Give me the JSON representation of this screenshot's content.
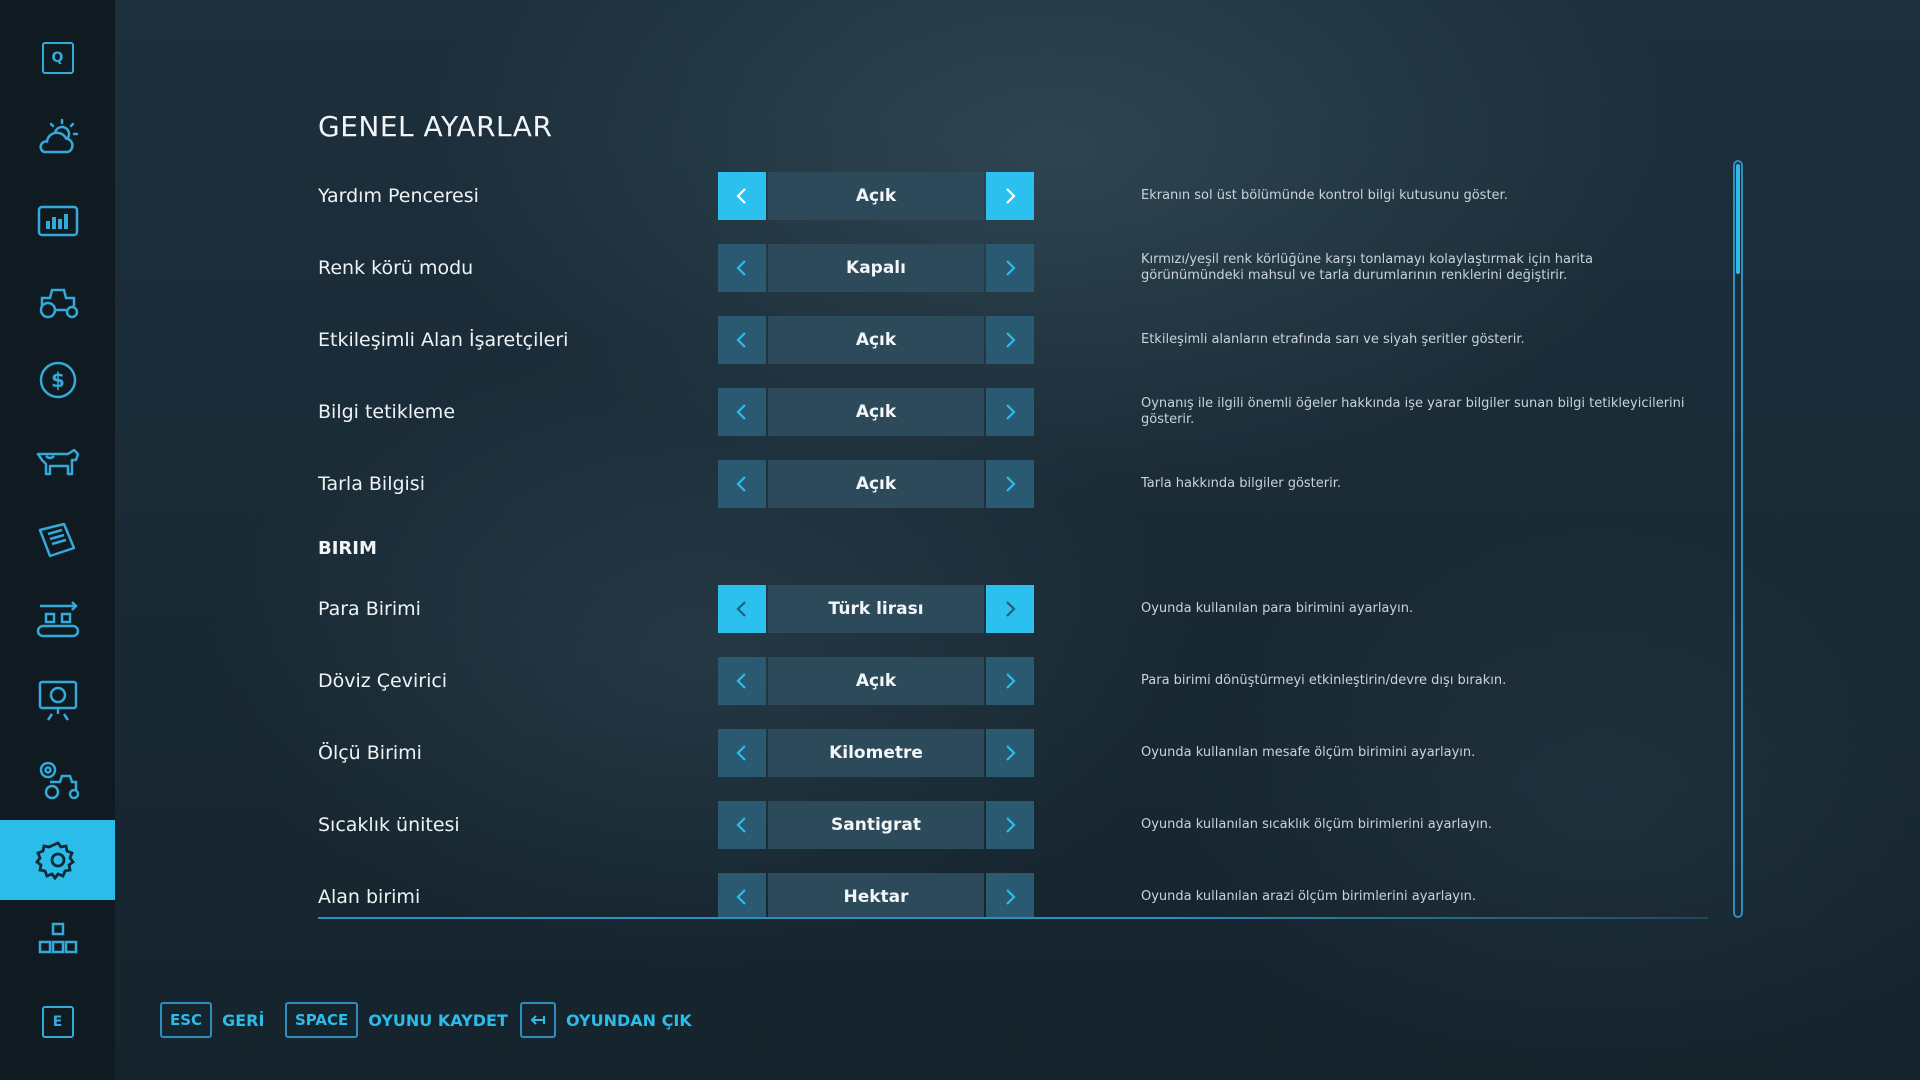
{
  "sidebar": {
    "top_key": "Q",
    "bottom_key": "E",
    "items": [
      {
        "icon": "weather-icon"
      },
      {
        "icon": "statistics-icon"
      },
      {
        "icon": "tractor-icon"
      },
      {
        "icon": "finances-icon"
      },
      {
        "icon": "animals-icon"
      },
      {
        "icon": "contracts-icon"
      },
      {
        "icon": "production-icon"
      },
      {
        "icon": "tutorial-icon"
      },
      {
        "icon": "vehicle-settings-icon"
      },
      {
        "icon": "settings-gear-icon",
        "active": true
      },
      {
        "icon": "mods-icon"
      }
    ]
  },
  "page": {
    "title": "GENEL AYARLAR"
  },
  "settings": {
    "general": [
      {
        "label": "Yardım Penceresi",
        "value": "Açık",
        "description": "Ekranın sol üst bölümünde kontrol bilgi kutusunu göster.",
        "highlighted": true
      },
      {
        "label": "Renk körü modu",
        "value": "Kapalı",
        "description": "Kırmızı/yeşil renk körlüğüne karşı tonlamayı kolaylaştırmak için harita görünümündeki mahsul ve tarla durumlarının renklerini değiştirir."
      },
      {
        "label": "Etkileşimli Alan İşaretçileri",
        "value": "Açık",
        "description": "Etkileşimli alanların etrafında sarı ve siyah şeritler gösterir."
      },
      {
        "label": "Bilgi tetikleme",
        "value": "Açık",
        "description": "Oynanış ile ilgili önemli öğeler hakkında işe yarar bilgiler sunan bilgi tetikleyicilerini gösterir."
      },
      {
        "label": "Tarla Bilgisi",
        "value": "Açık",
        "description": "Tarla hakkında bilgiler gösterir."
      }
    ],
    "unit_section_title": "BIRIM",
    "units": [
      {
        "label": "Para Birimi",
        "value": "Türk lirası",
        "description": "Oyunda kullanılan para birimini ayarlayın.",
        "highlighted": true
      },
      {
        "label": "Döviz Çevirici",
        "value": "Açık",
        "description": "Para birimi dönüştürmeyi etkinleştirin/devre dışı bırakın."
      },
      {
        "label": "Ölçü Birimi",
        "value": "Kilometre",
        "description": "Oyunda kullanılan mesafe ölçüm birimini ayarlayın."
      },
      {
        "label": "Sıcaklık ünitesi",
        "value": "Santigrat",
        "description": "Oyunda kullanılan sıcaklık ölçüm birimlerini ayarlayın."
      },
      {
        "label": "Alan birimi",
        "value": "Hektar",
        "description": "Oyunda kullanılan arazi ölçüm birimlerini ayarlayın."
      }
    ]
  },
  "footer": {
    "back": {
      "key": "ESC",
      "label": "GERİ"
    },
    "save": {
      "key": "SPACE",
      "label": "OYUNU KAYDET"
    },
    "quit": {
      "key_icon": "exit-arrow-icon",
      "label": "OYUNDAN ÇIK"
    }
  },
  "colors": {
    "accent": "#2bbcea",
    "selector_bg": "#2d4a5a",
    "arrow_bg": "#2a5a72",
    "sidebar_bg": "#0f1a21"
  }
}
